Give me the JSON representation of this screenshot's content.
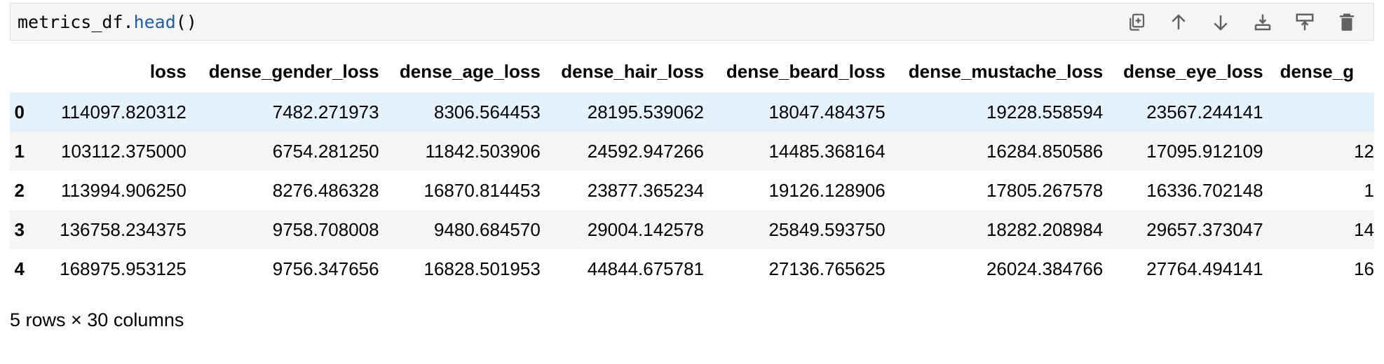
{
  "cell": {
    "code_object": "metrics_df",
    "code_dot": ".",
    "code_method": "head",
    "code_parens": "()",
    "toolbar_icons": [
      "duplicate-icon",
      "move-up-icon",
      "move-down-icon",
      "insert-below-icon",
      "insert-above-icon",
      "delete-icon"
    ]
  },
  "table": {
    "columns": [
      "loss",
      "dense_gender_loss",
      "dense_age_loss",
      "dense_hair_loss",
      "dense_beard_loss",
      "dense_mustache_loss",
      "dense_eye_loss",
      "dense_g"
    ],
    "rows": [
      {
        "index": "0",
        "values": [
          "114097.820312",
          "7482.271973",
          "8306.564453",
          "28195.539062",
          "18047.484375",
          "19228.558594",
          "23567.244141",
          ""
        ]
      },
      {
        "index": "1",
        "values": [
          "103112.375000",
          "6754.281250",
          "11842.503906",
          "24592.947266",
          "14485.368164",
          "16284.850586",
          "17095.912109",
          "12"
        ]
      },
      {
        "index": "2",
        "values": [
          "113994.906250",
          "8276.486328",
          "16870.814453",
          "23877.365234",
          "19126.128906",
          "17805.267578",
          "16336.702148",
          "1"
        ]
      },
      {
        "index": "3",
        "values": [
          "136758.234375",
          "9758.708008",
          "9480.684570",
          "29004.142578",
          "25849.593750",
          "18282.208984",
          "29657.373047",
          "14"
        ]
      },
      {
        "index": "4",
        "values": [
          "168975.953125",
          "9756.347656",
          "16828.501953",
          "44844.675781",
          "27136.765625",
          "26024.384766",
          "27764.494141",
          "16"
        ]
      }
    ],
    "highlighted_row": 0,
    "highlight_color": "#e3f2fd"
  },
  "footer": {
    "summary": "5 rows × 30 columns"
  }
}
